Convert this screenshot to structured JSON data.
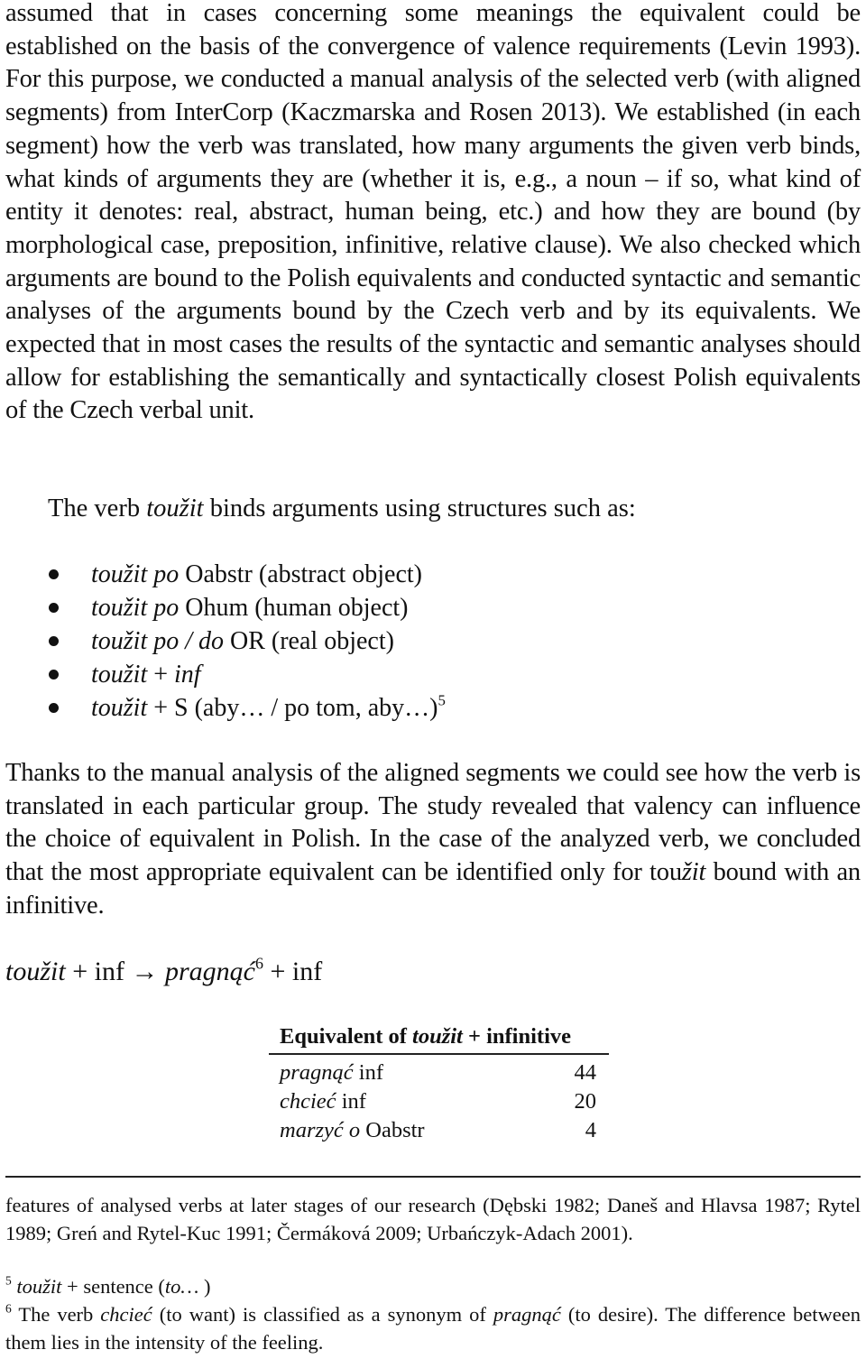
{
  "paragraph_1": "assumed that in cases concerning some meanings the equivalent could be established on the basis of the convergence of valence requirements (Levin 1993). For this purpose, we conducted a manual analysis of the selected verb (with aligned segments) from InterCorp (Kaczmarska and Rosen 2013). We established (in each segment) how the verb was translated, how many arguments the given verb binds, what kinds of arguments they are (whether it is, e.g., a noun – if so, what kind of entity it denotes: real, abstract, human being, etc.) and how they are bound (by morphological case, preposition, infinitive, relative clause). We also checked which arguments are bound to the Polish equivalents and conducted syntactic and semantic analyses of the arguments bound by the Czech verb and by its equivalents. We expected that in most cases the results of the syntactic and semantic analyses should allow for establishing the semantically and syntactically closest Polish equivalents of the Czech verbal unit.",
  "intro": {
    "before": "The verb ",
    "verb": "toužit",
    "after": " binds arguments using structures such as:"
  },
  "structures": [
    {
      "italic": "toužit po",
      "plain": " Oabstr (abstract object)",
      "sup": ""
    },
    {
      "italic": "toužit po",
      "plain": " Ohum (human object)",
      "sup": ""
    },
    {
      "italic": "toužit po / do",
      "plain": " OR (real object)",
      "sup": ""
    },
    {
      "italic": "toužit",
      "plain": " + ",
      "italic2": "inf",
      "sup": ""
    },
    {
      "italic": "toužit",
      "plain": " + S (aby… / po tom, aby…)",
      "sup": "5"
    }
  ],
  "paragraph_2": {
    "before": "Thanks to the manual analysis of the aligned segments we could see how the verb is translated in each particular group. The study revealed that valency can influence the choice of equivalent in Polish. In the case of the analyzed verb, we concluded that the most appropriate equivalent can be identified only for tou",
    "italic": "žit",
    "after": " bound with an infinitive."
  },
  "formula": {
    "source_verb": "toužit",
    "source_rest": " + inf ",
    "arrow": "→",
    "target_verb": " pragnąć",
    "sup": "6",
    "target_rest": " + inf"
  },
  "table": {
    "header": {
      "before": "Equivalent of ",
      "italic": "toužit",
      "after": " + infinitive"
    },
    "rows": [
      {
        "italic": "pragnąć",
        "plain": " inf",
        "count": "44"
      },
      {
        "italic": "chcieć",
        "plain": " inf",
        "count": "20"
      },
      {
        "italic": "marzyć o",
        "plain": " Oabstr",
        "count": "4"
      }
    ]
  },
  "footnotes": {
    "continuation": "features of analysed verbs at later stages of our research (Dębski 1982; Daneš and Hlavsa 1987; Rytel 1989; Greń and Rytel-Kuc 1991; Čermáková 2009; Urbańczyk-Adach 2001).",
    "fn5": {
      "num": "5",
      "italic": "toužit",
      "plain": " + sentence (",
      "italic2": "to…",
      "end": " )"
    },
    "fn6": {
      "num": "6",
      "before": " The verb ",
      "italic": "chcieć",
      "middle": " (to want) is classified as a synonym of ",
      "italic2": "pragnąć",
      "after": " (to desire). The difference between them lies in the intensity of the feeling."
    }
  }
}
